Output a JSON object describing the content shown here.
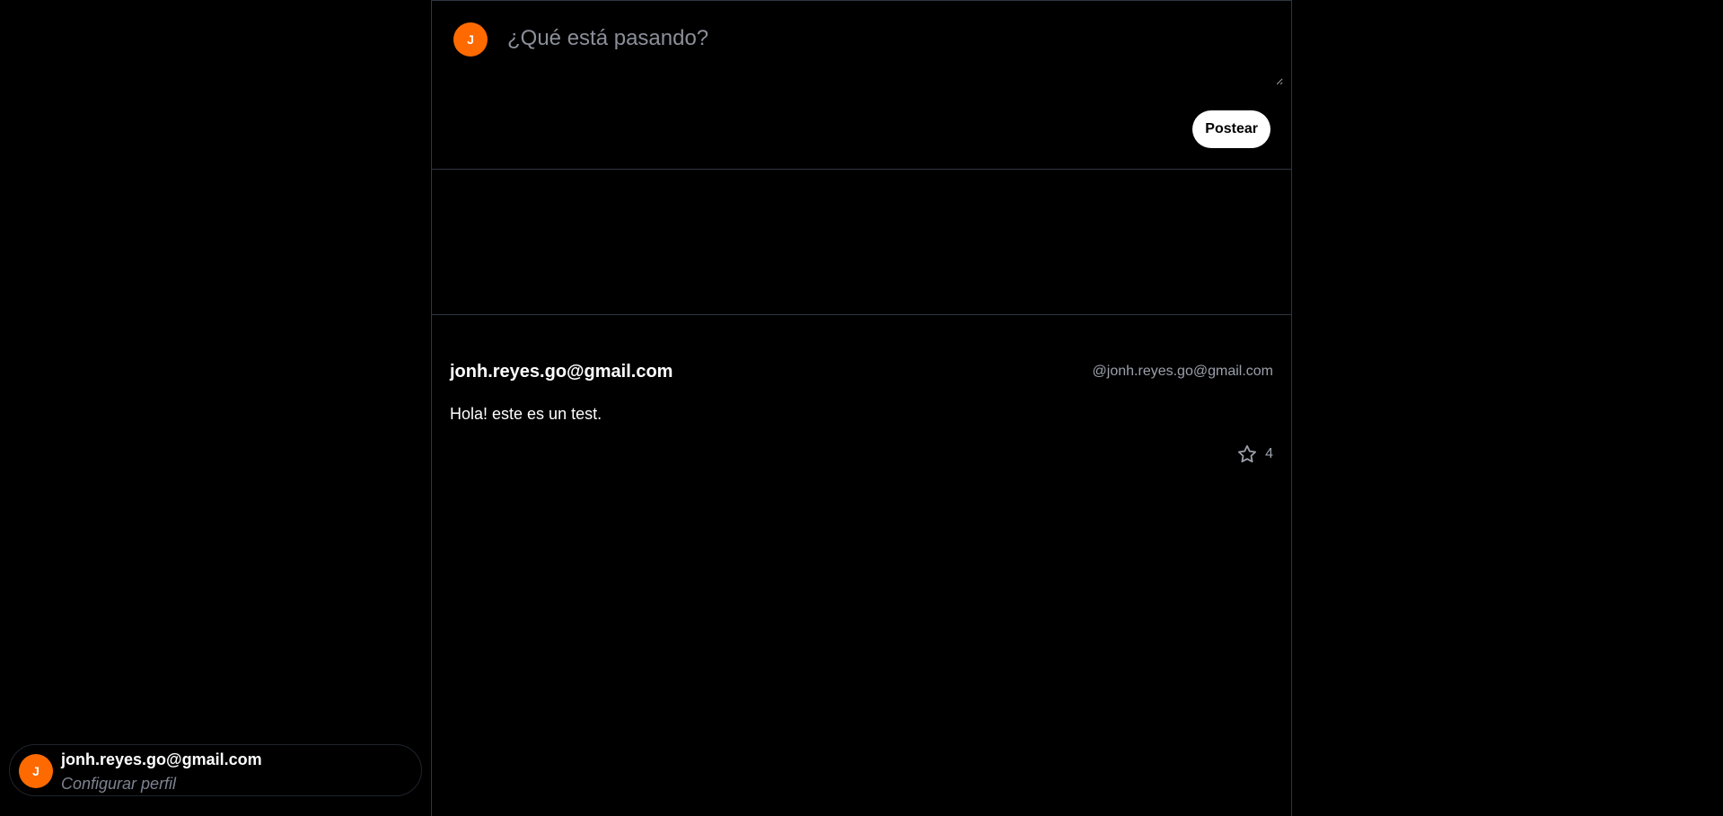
{
  "composer": {
    "avatar_initial": "J",
    "placeholder": "¿Qué está pasando?",
    "post_button_label": "Postear"
  },
  "posts": [
    {
      "author": "jonh.reyes.go@gmail.com",
      "handle": "@jonh.reyes.go@gmail.com",
      "text": "Hola! este es un test.",
      "like_icon": "star-icon",
      "likes": "4"
    }
  ],
  "profile": {
    "avatar_initial": "J",
    "name": "jonh.reyes.go@gmail.com",
    "subtitle": "Configurar perfil"
  },
  "colors": {
    "background": "#000000",
    "avatar": "#ff6a00",
    "border": "#2f3640",
    "muted_text": "#9aa0aa"
  }
}
